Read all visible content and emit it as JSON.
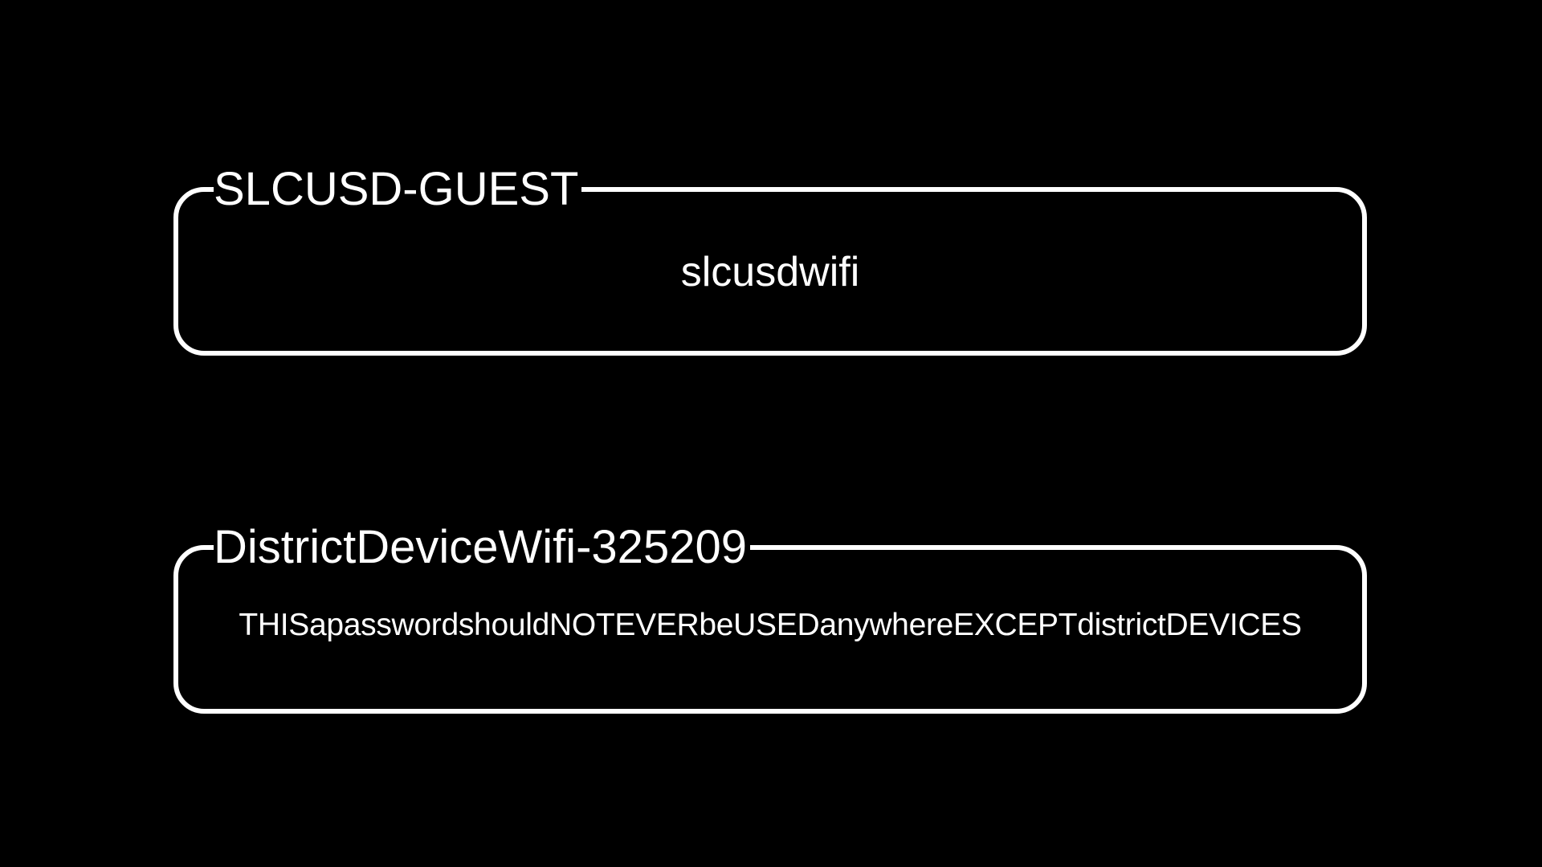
{
  "networks": [
    {
      "ssid": "SLCUSD-GUEST",
      "password": "slcusdwifi"
    },
    {
      "ssid": "DistrictDeviceWifi-325209",
      "password": "THISapasswordshouldNOTEVERbeUSEDanywhereEXCEPTdistrictDEVICES"
    }
  ],
  "colors": {
    "background": "#000000",
    "foreground": "#ffffff"
  }
}
